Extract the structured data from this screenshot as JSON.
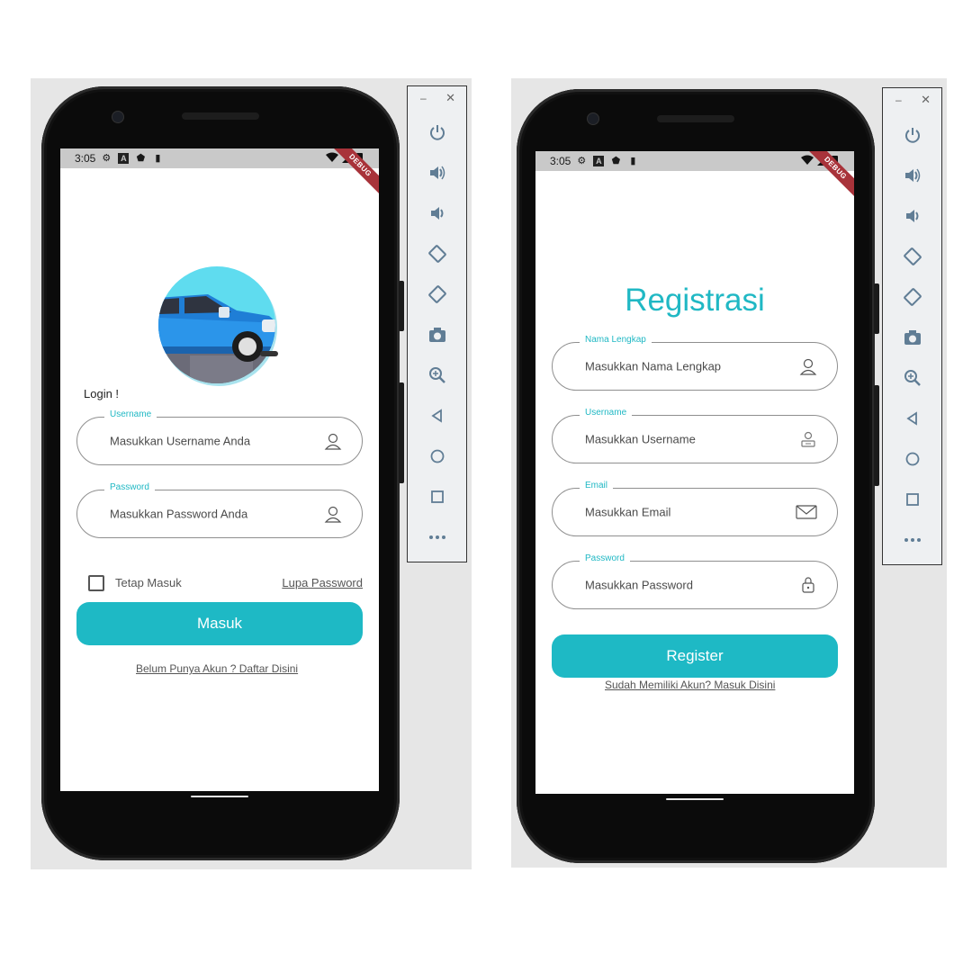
{
  "colors": {
    "accent": "#1eb9c5",
    "teal_label": "#20b8c4",
    "debug_banner": "#a8333a"
  },
  "left": {
    "status": {
      "time": "3:05",
      "debug_banner": "DEBUG"
    },
    "login_title": "Login !",
    "username": {
      "label": "Username",
      "placeholder": "Masukkan Username Anda",
      "icon": "person-icon"
    },
    "password": {
      "label": "Password",
      "placeholder": "Masukkan Password Anda",
      "icon": "person-icon"
    },
    "remember_label": "Tetap Masuk",
    "forgot_link": "Lupa Password",
    "submit": "Masuk",
    "register_link": "Belum Punya Akun ? Daftar Disini"
  },
  "right": {
    "status": {
      "time": "3:05",
      "debug_banner": "DEBUG"
    },
    "title": "Registrasi",
    "fields": [
      {
        "label": "Nama Lengkap",
        "placeholder": "Masukkan Nama Lengkap",
        "icon": "person-icon"
      },
      {
        "label": "Username",
        "placeholder": "Masukkan Username",
        "icon": "user-badge-icon"
      },
      {
        "label": "Email",
        "placeholder": "Masukkan Email",
        "icon": "envelope-icon"
      },
      {
        "label": "Password",
        "placeholder": "Masukkan Password",
        "icon": "lock-icon"
      }
    ],
    "submit": "Register",
    "login_link": "Sudah Memiliki Akun? Masuk Disini"
  },
  "emulator_toolbar": {
    "window_controls": [
      "minimize",
      "close"
    ],
    "buttons": [
      "power-icon",
      "volume-up-icon",
      "volume-down-icon",
      "rotate-left-icon",
      "rotate-right-icon",
      "camera-icon",
      "zoom-icon",
      "back-icon",
      "home-icon",
      "overview-icon",
      "more-icon"
    ]
  }
}
